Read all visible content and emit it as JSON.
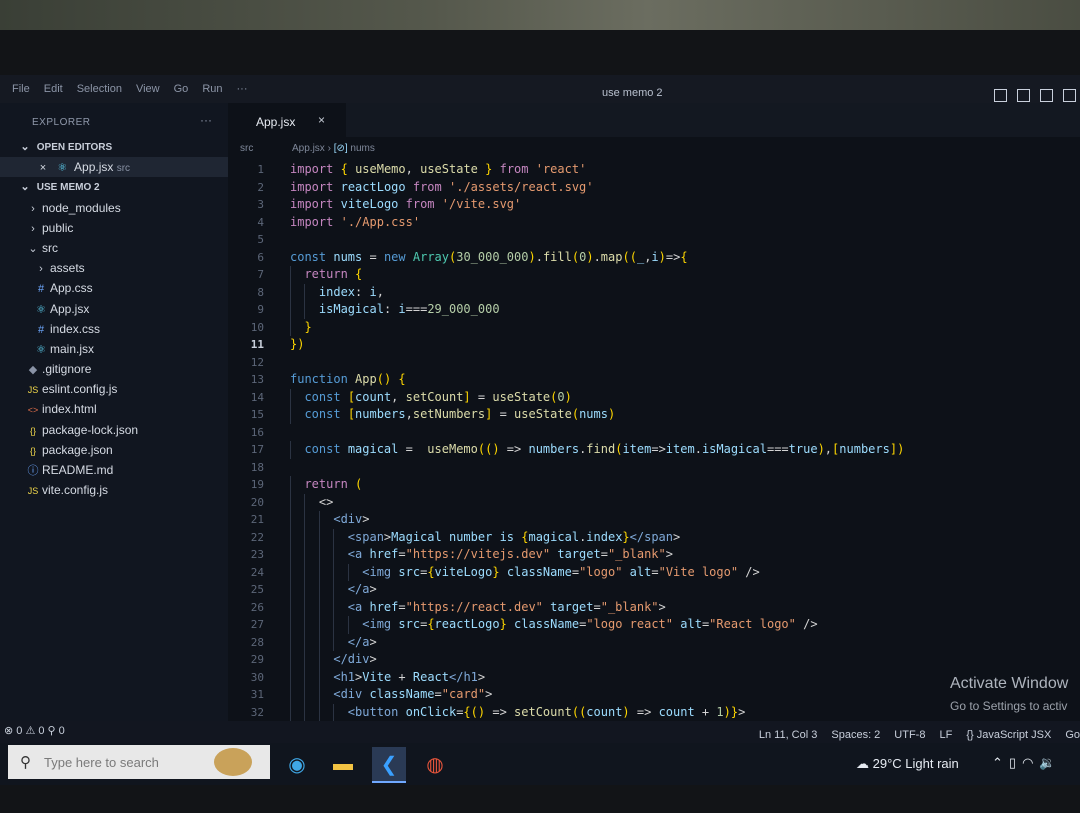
{
  "menu": [
    "File",
    "Edit",
    "Selection",
    "View",
    "Go",
    "Run",
    "···"
  ],
  "window_title": "use memo 2",
  "explorer": {
    "title": "EXPLORER",
    "more": "···",
    "open_editors_label": "OPEN EDITORS",
    "open_file": "App.jsx",
    "open_file_dir": "src",
    "project_label": "USE MEMO 2",
    "items": [
      {
        "label": "node_modules",
        "icon": "chevron-right",
        "indent": 1
      },
      {
        "label": "public",
        "icon": "chevron-right",
        "indent": 1
      },
      {
        "label": "src",
        "icon": "chevron-down",
        "indent": 1
      },
      {
        "label": "assets",
        "icon": "chevron-right",
        "indent": 2
      },
      {
        "label": "App.css",
        "icon": "#",
        "indent": 2
      },
      {
        "label": "App.jsx",
        "icon": "react",
        "indent": 2
      },
      {
        "label": "index.css",
        "icon": "#",
        "indent": 2
      },
      {
        "label": "main.jsx",
        "icon": "react",
        "indent": 2
      },
      {
        "label": ".gitignore",
        "icon": "git",
        "indent": 1
      },
      {
        "label": "eslint.config.js",
        "icon": "JS",
        "indent": 1
      },
      {
        "label": "index.html",
        "icon": "<>",
        "indent": 1
      },
      {
        "label": "package-lock.json",
        "icon": "{}",
        "indent": 1
      },
      {
        "label": "package.json",
        "icon": "{}",
        "indent": 1
      },
      {
        "label": "README.md",
        "icon": "info",
        "indent": 1
      },
      {
        "label": "vite.config.js",
        "icon": "JS",
        "indent": 1
      }
    ]
  },
  "tab": {
    "label": "App.jsx",
    "close": "×"
  },
  "breadcrumb": {
    "part1": "src",
    "part2": "App.jsx",
    "part3": "nums"
  },
  "code_lines": [
    {
      "n": "1",
      "text": "import { useMemo, useState } from 'react'"
    },
    {
      "n": "2",
      "text": "import reactLogo from './assets/react.svg'"
    },
    {
      "n": "3",
      "text": "import viteLogo from '/vite.svg'"
    },
    {
      "n": "4",
      "text": "import './App.css'"
    },
    {
      "n": "5",
      "text": ""
    },
    {
      "n": "6",
      "text": "const nums = new Array(30_000_000).fill(0).map((_,i)=>{"
    },
    {
      "n": "7",
      "text": "  return {"
    },
    {
      "n": "8",
      "text": "    index: i,"
    },
    {
      "n": "9",
      "text": "    isMagical: i===29_000_000"
    },
    {
      "n": "10",
      "text": "  }"
    },
    {
      "n": "11",
      "text": "})"
    },
    {
      "n": "12",
      "text": ""
    },
    {
      "n": "13",
      "text": "function App() {"
    },
    {
      "n": "14",
      "text": "  const [count, setCount] = useState(0)"
    },
    {
      "n": "15",
      "text": "  const [numbers,setNumbers] = useState(nums)"
    },
    {
      "n": "16",
      "text": ""
    },
    {
      "n": "17",
      "text": "  const magical =  useMemo(() => numbers.find(item=>item.isMagical===true),[numbers])"
    },
    {
      "n": "18",
      "text": ""
    },
    {
      "n": "19",
      "text": "  return ("
    },
    {
      "n": "20",
      "text": "    <>"
    },
    {
      "n": "21",
      "text": "      <div>"
    },
    {
      "n": "22",
      "text": "        <span>Magical number is {magical.index}</span>"
    },
    {
      "n": "23",
      "text": "        <a href=\"https://vitejs.dev\" target=\"_blank\">"
    },
    {
      "n": "24",
      "text": "          <img src={viteLogo} className=\"logo\" alt=\"Vite logo\" />"
    },
    {
      "n": "25",
      "text": "        </a>"
    },
    {
      "n": "26",
      "text": "        <a href=\"https://react.dev\" target=\"_blank\">"
    },
    {
      "n": "27",
      "text": "          <img src={reactLogo} className=\"logo react\" alt=\"React logo\" />"
    },
    {
      "n": "28",
      "text": "        </a>"
    },
    {
      "n": "29",
      "text": "      </div>"
    },
    {
      "n": "30",
      "text": "      <h1>Vite + React</h1>"
    },
    {
      "n": "31",
      "text": "      <div className=\"card\">"
    },
    {
      "n": "32",
      "text": "        <button onClick={() => setCount((count) => count + 1)}>"
    }
  ],
  "current_line": "11",
  "watermark": {
    "line1": "Activate Window",
    "line2": "Go to Settings to activ"
  },
  "status": {
    "left": "⊗ 0 ⚠ 0   ⚲ 0",
    "position": "Ln 11, Col 3",
    "spaces": "Spaces: 2",
    "encoding": "UTF-8",
    "eol": "LF",
    "language": "{} JavaScript JSX",
    "extra": "Go"
  },
  "taskbar": {
    "search_placeholder": "Type here to search",
    "temperature": "29°C",
    "weather": "Light rain"
  },
  "colors": {
    "editor_bg": "#0d1118",
    "sidebar_bg": "#111620",
    "keyword": "#c586c0",
    "string": "#e59a6f",
    "function": "#dcdcaa"
  }
}
